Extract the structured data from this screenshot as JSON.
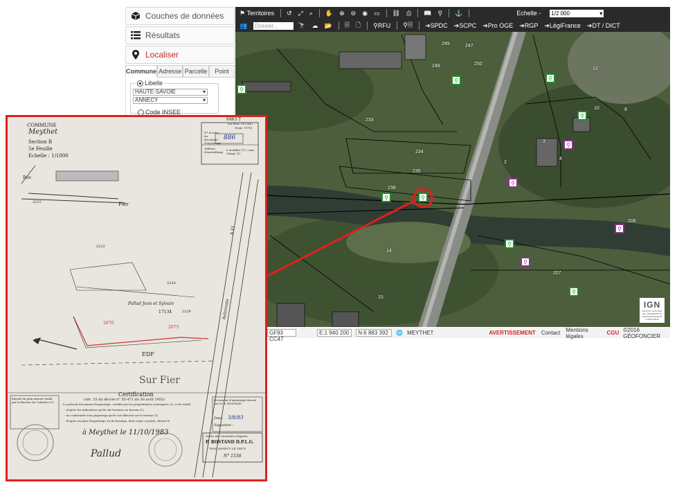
{
  "sidebar": {
    "items": [
      {
        "label": "Couches de données",
        "icon": "cube-icon"
      },
      {
        "label": "Résultats",
        "icon": "list-icon"
      },
      {
        "label": "Localiser",
        "icon": "map-pin-icon",
        "active": true
      }
    ],
    "tabs": [
      "Commune",
      "Adresse",
      "Parcelle",
      "Point"
    ],
    "selected_tab": "Commune",
    "libelle_label": "Libelle",
    "department": "HAUTE-SAVOIE",
    "commune": "ANNECY",
    "code_insee_label": "Code INSEE"
  },
  "toolbar": {
    "territoires": "Territoires",
    "dossier_placeholder": "Dossier...",
    "echelle_label": "Echelle -",
    "scale_value": "1/2 000",
    "rfu": "RFU",
    "links": [
      "SPDC",
      "SCPC",
      "Pro OGE",
      "RGP",
      "LégiFrance",
      "DT / DICT"
    ]
  },
  "map": {
    "parcel_numbers": [
      "249",
      "247",
      "250",
      "248",
      "233",
      "234",
      "235",
      "238",
      "10",
      "12",
      "8",
      "3",
      "2",
      "4",
      "14",
      "15",
      "206",
      "207"
    ],
    "ign_logo": "IGN",
    "ign_sub": "INSTITUT NATIONAL DE L'INFORMATION GÉOGRAPHIQUE ET FORESTIÈRE"
  },
  "statusbar": {
    "projection": "GF93 CC47",
    "east": "E:1 940 200",
    "north": "N:6 883 392",
    "place": "MEYTHET",
    "avertissement": "AVERTISSEMENT",
    "contact": "Contact",
    "mentions": "Mentions légales",
    "cgu": "CGU",
    "copyright": "©2016 GÉOFONCIER"
  },
  "document": {
    "commune_label": "COMMUNE",
    "commune_value": "Meythet",
    "section": "Section  B",
    "feuille": "5e Feuille",
    "echelle": "Echelle : 1/1000",
    "form_no": "6463 T",
    "form_sub": "(ex-Mod. 30 Cad.)",
    "form_date": "(Sept. 1976)",
    "ordre_label": "N° d'ordre du document d'arpentage",
    "ordre_value": "886",
    "tableau_label": "Tableau d'assemblage",
    "tableau_options": "à modifier (1) / sans chang' (1)",
    "road": "Rue",
    "river_top": "Fier",
    "river_bottom": "Sur Fier",
    "parcels": [
      "2221",
      "2222",
      "2224",
      "2229",
      "2676",
      "2675"
    ],
    "owner_note": "Pallud Jean et Sylvain",
    "owner_code": "17134",
    "edf": "EDF",
    "route": "Autoroute",
    "route_no": "A 41",
    "certification_title": "Certification",
    "certification_ref": "(Art. 25 du décret n° 55-471 du 30 avril 1955)",
    "cert_line1": "Le présent document d'arpentage, certifié par les propriétaires soussignés (3), a été établi",
    "cert_line2": "- d'après les indications qu'ils ont fournies au bureau (1).",
    "cert_line3": "- en conformité d'un piquetage qu'ils ont effectué sur le terrain (1).",
    "cert_line4": "- d'après un plan d'arpentage ou de bornage, dont copie ci-jointe, dressé le",
    "extrait_label": "Extrait du plan minute établi par le Bureau du Cadastre (1)",
    "doc_dresse": "Document d'arpentage dressé par M. P. ROSTAND",
    "date_label": "Date :",
    "date_value": "3/8/83",
    "signature_label": "Signature :",
    "place_date": "à  Meythet  le  11/10/1983",
    "signature_name": "Pallud",
    "stamp_title": "Ordre des Géomètres Experts",
    "stamp_name": "P. ROSTAND D.P.L.G.",
    "stamp_addr": "74000 ANNECY LE VIEUX",
    "stamp_no": "N° 1538"
  },
  "colors": {
    "accent": "#c8282a",
    "toolbar_bg": "#2a2a2a",
    "frame": "#e0201c",
    "marker_green": "#1f8b2a",
    "marker_purple": "#8b2f8b"
  }
}
